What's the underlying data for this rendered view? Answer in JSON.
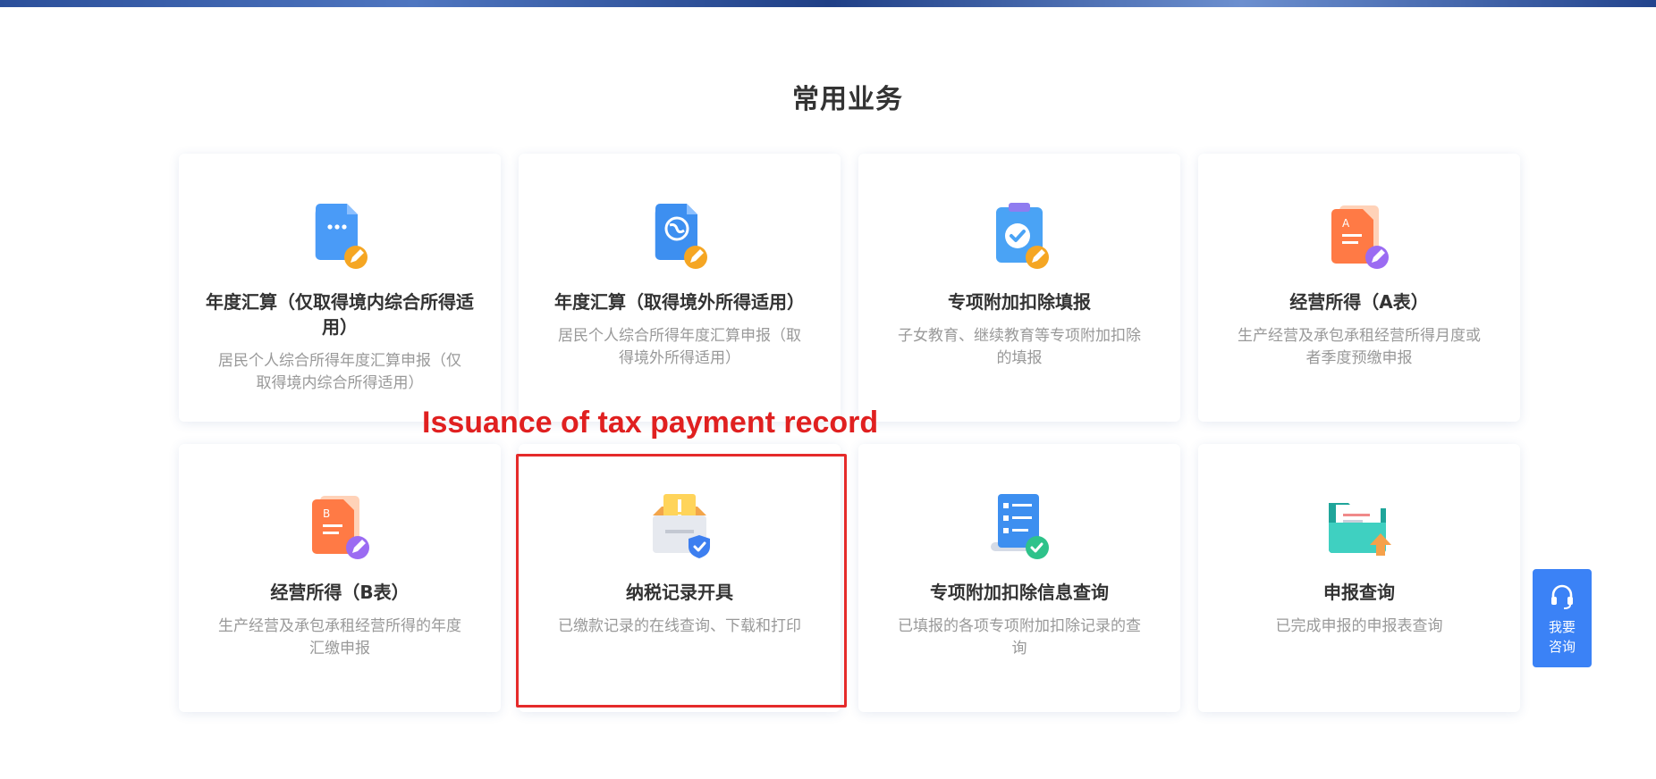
{
  "section": {
    "title": "常用业务"
  },
  "cards": [
    {
      "title": "年度汇算（仅取得境内综合所得适用）",
      "desc": "居民个人综合所得年度汇算申报（仅取得境内综合所得适用）",
      "icon": "document-edit-icon"
    },
    {
      "title": "年度汇算（取得境外所得适用）",
      "desc": "居民个人综合所得年度汇算申报（取得境外所得适用）",
      "icon": "globe-document-icon"
    },
    {
      "title": "专项附加扣除填报",
      "desc": "子女教育、继续教育等专项附加扣除的填报",
      "icon": "clipboard-check-icon"
    },
    {
      "title": "经营所得（A表）",
      "desc": "生产经营及承包承租经营所得月度或者季度预缴申报",
      "icon": "form-a-icon"
    },
    {
      "title": "经营所得（B表）",
      "desc": "生产经营及承包承租经营所得的年度汇缴申报",
      "icon": "form-b-icon"
    },
    {
      "title": "纳税记录开具",
      "desc": "已缴款记录的在线查询、下载和打印",
      "icon": "inbox-shield-icon"
    },
    {
      "title": "专项附加扣除信息查询",
      "desc": "已填报的各项专项附加扣除记录的查询",
      "icon": "checklist-scroll-icon"
    },
    {
      "title": "申报查询",
      "desc": "已完成申报的申报表查询",
      "icon": "folder-upload-icon"
    }
  ],
  "annotation": {
    "text": "Issuance of tax payment record",
    "color": "#e02020"
  },
  "consult": {
    "line1": "我要",
    "line2": "咨询",
    "icon": "headset-icon"
  },
  "colors": {
    "accent": "#3b82f6",
    "highlight": "#e52a2a"
  }
}
